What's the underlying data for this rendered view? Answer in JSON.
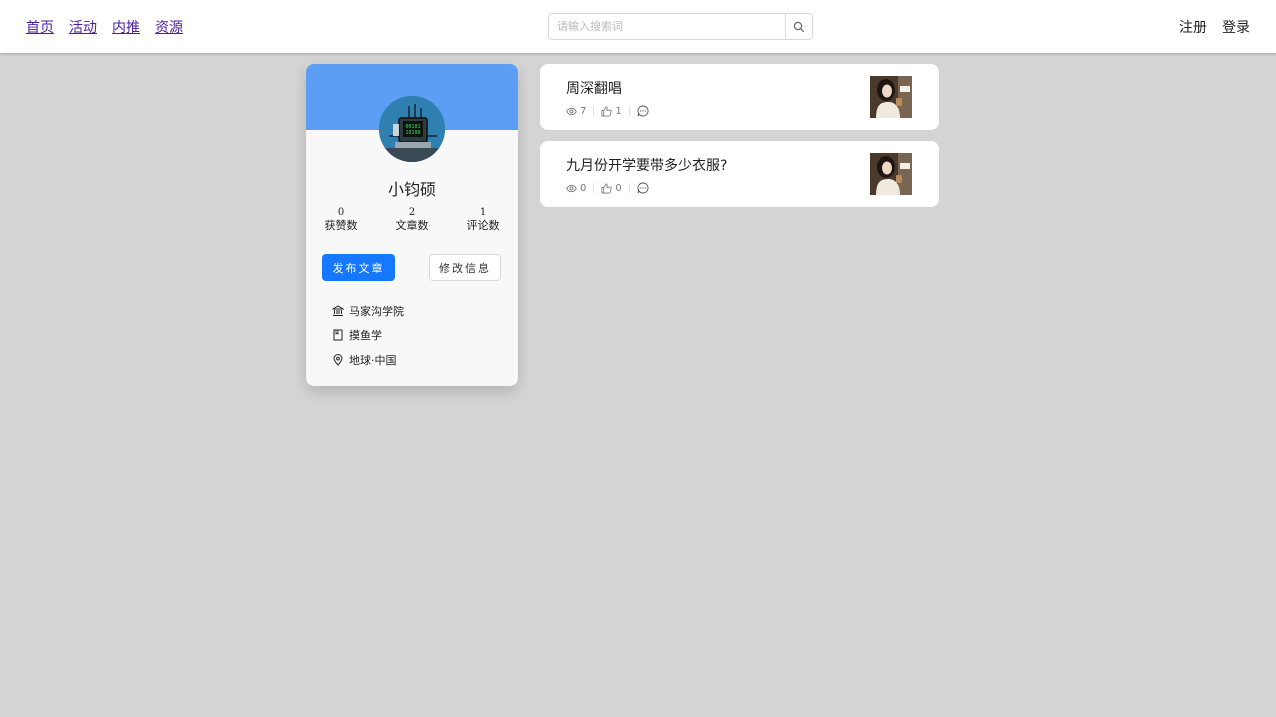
{
  "nav": {
    "links": [
      "首页",
      "活动",
      "内推",
      "资源"
    ],
    "search_placeholder": "请输入搜索词",
    "register": "注册",
    "login": "登录"
  },
  "profile": {
    "name": "小钧硕",
    "stats": [
      {
        "value": "0",
        "label": "获赞数"
      },
      {
        "value": "2",
        "label": "文章数"
      },
      {
        "value": "1",
        "label": "评论数"
      }
    ],
    "publish_button": "发布文章",
    "edit_button": "修改信息",
    "school": "马家沟学院",
    "major": "摸鱼学",
    "location": "地球·中国"
  },
  "articles": [
    {
      "title": "周深翻唱",
      "views": "7",
      "likes": "1"
    },
    {
      "title": "九月份开学要带多少衣服?",
      "views": "0",
      "likes": "0"
    }
  ],
  "colors": {
    "accent": "#1677ff",
    "banner": "#5b9ef4",
    "background": "#d4d4d4"
  }
}
